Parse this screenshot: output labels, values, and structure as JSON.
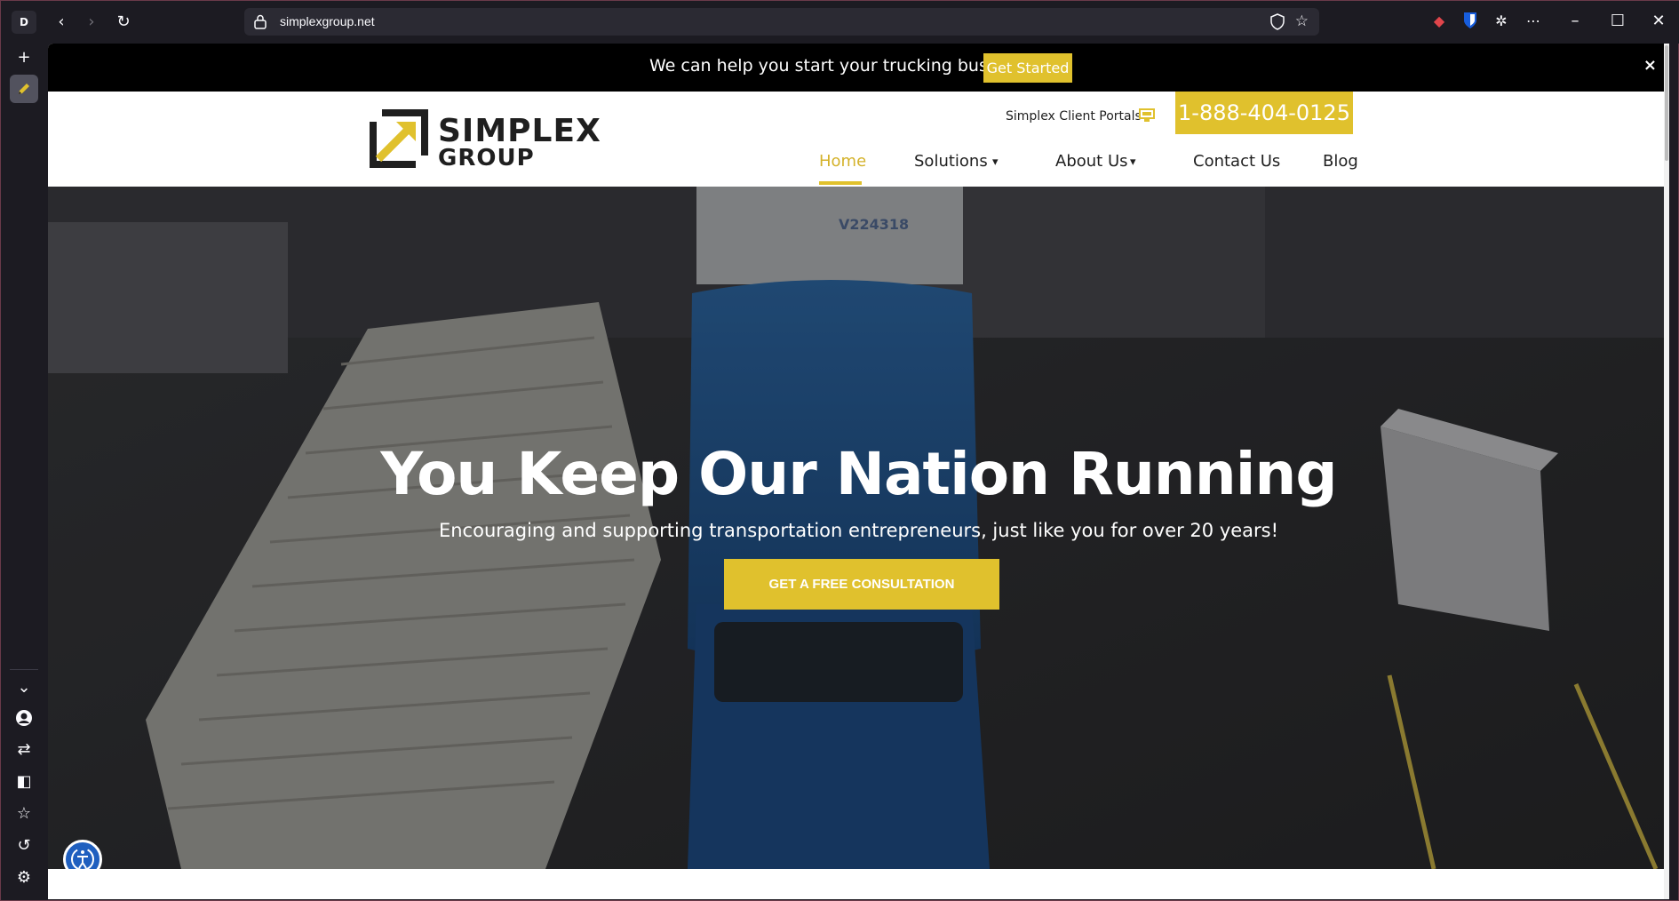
{
  "browser": {
    "profile_initial": "D",
    "url": "simplexgroup.net",
    "icons": {
      "back": "back-arrow-icon",
      "forward": "forward-arrow-icon",
      "reload": "reload-icon",
      "lock": "lock-icon",
      "shield": "shield-icon",
      "bookmark": "star-icon",
      "extensions": [
        "eraser-extension-icon",
        "bitwarden-icon",
        "puzzle-icon",
        "more-icon"
      ],
      "window": [
        "minimize-icon",
        "maximize-icon",
        "close-icon"
      ]
    }
  },
  "sidebar": {
    "top": [
      "plus-icon",
      "pen-icon"
    ],
    "bottom": [
      "chevron-down-icon",
      "avatar-icon",
      "sync-icon",
      "sidebar-panel-icon",
      "star-icon",
      "history-icon",
      "settings-icon"
    ]
  },
  "page": {
    "promo": {
      "message": "We can help you start your trucking business!",
      "cta": "Get Started",
      "close": "×"
    },
    "header": {
      "logo_line1": "SIMPLEX",
      "logo_line2": "GROUP",
      "client_portals": "Simplex Client Portals",
      "phone": "1-888-404-0125",
      "nav": [
        {
          "label": "Home",
          "active": true
        },
        {
          "label": "Solutions",
          "dropdown": true
        },
        {
          "label": "About Us",
          "dropdown": true
        },
        {
          "label": "Contact Us"
        },
        {
          "label": "Blog"
        }
      ],
      "dropdown_caret": "▾"
    },
    "hero": {
      "title": "You Keep Our Nation Running",
      "subtitle": "Encouraging and supporting transportation entrepreneurs, just like you for over 20 years!",
      "cta": "GET A FREE CONSULTATION",
      "truck_id": "V224318"
    },
    "accessibility": {
      "icon": "accessibility-icon"
    }
  },
  "colors": {
    "accent": "#e0c12d",
    "browser_bg": "#1c1b22",
    "promo_bg": "#000000",
    "text_dark": "#1f1f1f"
  }
}
